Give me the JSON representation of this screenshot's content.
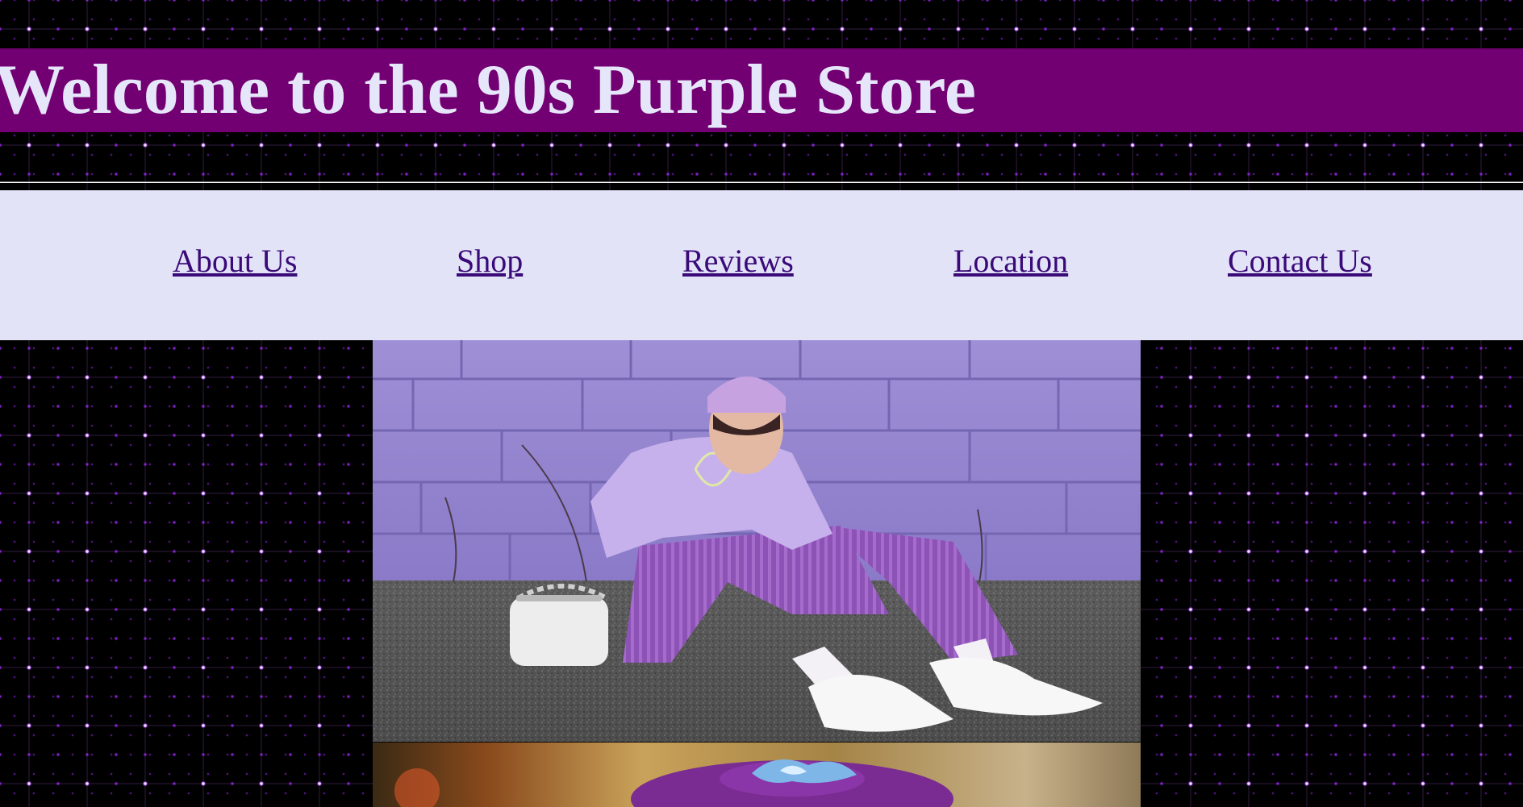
{
  "header": {
    "title": "Welcome to the 90s Purple Store"
  },
  "nav": {
    "items": [
      {
        "label": "About Us"
      },
      {
        "label": "Shop"
      },
      {
        "label": "Reviews"
      },
      {
        "label": "Location"
      },
      {
        "label": "Contact Us"
      }
    ]
  },
  "colors": {
    "banner": "#720072",
    "title_text": "#e6e6fa",
    "nav_background": "#e3e3f8",
    "nav_link": "#3a0a78",
    "page_background": "#000000",
    "star_accent": "#b03cff"
  },
  "images": [
    {
      "name": "lavender-outfit-photo"
    },
    {
      "name": "purple-hat-photo"
    }
  ]
}
